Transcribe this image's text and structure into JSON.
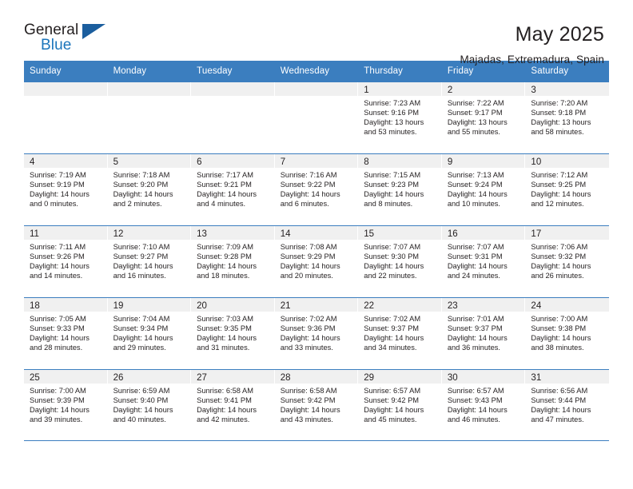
{
  "brand": {
    "word1": "General",
    "word2": "Blue",
    "triangle_color": "#1b5e9e",
    "blue_color": "#1b75bb"
  },
  "header": {
    "title": "May 2025",
    "subtitle": "Majadas, Extremadura, Spain"
  },
  "theme": {
    "header_band": "#3b7ebf",
    "daynum_band": "#f0f0f0",
    "text": "#231f20"
  },
  "weekday_headers": [
    "Sunday",
    "Monday",
    "Tuesday",
    "Wednesday",
    "Thursday",
    "Friday",
    "Saturday"
  ],
  "labels": {
    "sunrise_prefix": "Sunrise: ",
    "sunset_prefix": "Sunset: ",
    "daylight_prefix": "Daylight: "
  },
  "weeks": [
    [
      {
        "day": ""
      },
      {
        "day": ""
      },
      {
        "day": ""
      },
      {
        "day": ""
      },
      {
        "day": "1",
        "sunrise": "Sunrise: 7:23 AM",
        "sunset": "Sunset: 9:16 PM",
        "daylight_l1": "Daylight: 13 hours",
        "daylight_l2": "and 53 minutes."
      },
      {
        "day": "2",
        "sunrise": "Sunrise: 7:22 AM",
        "sunset": "Sunset: 9:17 PM",
        "daylight_l1": "Daylight: 13 hours",
        "daylight_l2": "and 55 minutes."
      },
      {
        "day": "3",
        "sunrise": "Sunrise: 7:20 AM",
        "sunset": "Sunset: 9:18 PM",
        "daylight_l1": "Daylight: 13 hours",
        "daylight_l2": "and 58 minutes."
      }
    ],
    [
      {
        "day": "4",
        "sunrise": "Sunrise: 7:19 AM",
        "sunset": "Sunset: 9:19 PM",
        "daylight_l1": "Daylight: 14 hours",
        "daylight_l2": "and 0 minutes."
      },
      {
        "day": "5",
        "sunrise": "Sunrise: 7:18 AM",
        "sunset": "Sunset: 9:20 PM",
        "daylight_l1": "Daylight: 14 hours",
        "daylight_l2": "and 2 minutes."
      },
      {
        "day": "6",
        "sunrise": "Sunrise: 7:17 AM",
        "sunset": "Sunset: 9:21 PM",
        "daylight_l1": "Daylight: 14 hours",
        "daylight_l2": "and 4 minutes."
      },
      {
        "day": "7",
        "sunrise": "Sunrise: 7:16 AM",
        "sunset": "Sunset: 9:22 PM",
        "daylight_l1": "Daylight: 14 hours",
        "daylight_l2": "and 6 minutes."
      },
      {
        "day": "8",
        "sunrise": "Sunrise: 7:15 AM",
        "sunset": "Sunset: 9:23 PM",
        "daylight_l1": "Daylight: 14 hours",
        "daylight_l2": "and 8 minutes."
      },
      {
        "day": "9",
        "sunrise": "Sunrise: 7:13 AM",
        "sunset": "Sunset: 9:24 PM",
        "daylight_l1": "Daylight: 14 hours",
        "daylight_l2": "and 10 minutes."
      },
      {
        "day": "10",
        "sunrise": "Sunrise: 7:12 AM",
        "sunset": "Sunset: 9:25 PM",
        "daylight_l1": "Daylight: 14 hours",
        "daylight_l2": "and 12 minutes."
      }
    ],
    [
      {
        "day": "11",
        "sunrise": "Sunrise: 7:11 AM",
        "sunset": "Sunset: 9:26 PM",
        "daylight_l1": "Daylight: 14 hours",
        "daylight_l2": "and 14 minutes."
      },
      {
        "day": "12",
        "sunrise": "Sunrise: 7:10 AM",
        "sunset": "Sunset: 9:27 PM",
        "daylight_l1": "Daylight: 14 hours",
        "daylight_l2": "and 16 minutes."
      },
      {
        "day": "13",
        "sunrise": "Sunrise: 7:09 AM",
        "sunset": "Sunset: 9:28 PM",
        "daylight_l1": "Daylight: 14 hours",
        "daylight_l2": "and 18 minutes."
      },
      {
        "day": "14",
        "sunrise": "Sunrise: 7:08 AM",
        "sunset": "Sunset: 9:29 PM",
        "daylight_l1": "Daylight: 14 hours",
        "daylight_l2": "and 20 minutes."
      },
      {
        "day": "15",
        "sunrise": "Sunrise: 7:07 AM",
        "sunset": "Sunset: 9:30 PM",
        "daylight_l1": "Daylight: 14 hours",
        "daylight_l2": "and 22 minutes."
      },
      {
        "day": "16",
        "sunrise": "Sunrise: 7:07 AM",
        "sunset": "Sunset: 9:31 PM",
        "daylight_l1": "Daylight: 14 hours",
        "daylight_l2": "and 24 minutes."
      },
      {
        "day": "17",
        "sunrise": "Sunrise: 7:06 AM",
        "sunset": "Sunset: 9:32 PM",
        "daylight_l1": "Daylight: 14 hours",
        "daylight_l2": "and 26 minutes."
      }
    ],
    [
      {
        "day": "18",
        "sunrise": "Sunrise: 7:05 AM",
        "sunset": "Sunset: 9:33 PM",
        "daylight_l1": "Daylight: 14 hours",
        "daylight_l2": "and 28 minutes."
      },
      {
        "day": "19",
        "sunrise": "Sunrise: 7:04 AM",
        "sunset": "Sunset: 9:34 PM",
        "daylight_l1": "Daylight: 14 hours",
        "daylight_l2": "and 29 minutes."
      },
      {
        "day": "20",
        "sunrise": "Sunrise: 7:03 AM",
        "sunset": "Sunset: 9:35 PM",
        "daylight_l1": "Daylight: 14 hours",
        "daylight_l2": "and 31 minutes."
      },
      {
        "day": "21",
        "sunrise": "Sunrise: 7:02 AM",
        "sunset": "Sunset: 9:36 PM",
        "daylight_l1": "Daylight: 14 hours",
        "daylight_l2": "and 33 minutes."
      },
      {
        "day": "22",
        "sunrise": "Sunrise: 7:02 AM",
        "sunset": "Sunset: 9:37 PM",
        "daylight_l1": "Daylight: 14 hours",
        "daylight_l2": "and 34 minutes."
      },
      {
        "day": "23",
        "sunrise": "Sunrise: 7:01 AM",
        "sunset": "Sunset: 9:37 PM",
        "daylight_l1": "Daylight: 14 hours",
        "daylight_l2": "and 36 minutes."
      },
      {
        "day": "24",
        "sunrise": "Sunrise: 7:00 AM",
        "sunset": "Sunset: 9:38 PM",
        "daylight_l1": "Daylight: 14 hours",
        "daylight_l2": "and 38 minutes."
      }
    ],
    [
      {
        "day": "25",
        "sunrise": "Sunrise: 7:00 AM",
        "sunset": "Sunset: 9:39 PM",
        "daylight_l1": "Daylight: 14 hours",
        "daylight_l2": "and 39 minutes."
      },
      {
        "day": "26",
        "sunrise": "Sunrise: 6:59 AM",
        "sunset": "Sunset: 9:40 PM",
        "daylight_l1": "Daylight: 14 hours",
        "daylight_l2": "and 40 minutes."
      },
      {
        "day": "27",
        "sunrise": "Sunrise: 6:58 AM",
        "sunset": "Sunset: 9:41 PM",
        "daylight_l1": "Daylight: 14 hours",
        "daylight_l2": "and 42 minutes."
      },
      {
        "day": "28",
        "sunrise": "Sunrise: 6:58 AM",
        "sunset": "Sunset: 9:42 PM",
        "daylight_l1": "Daylight: 14 hours",
        "daylight_l2": "and 43 minutes."
      },
      {
        "day": "29",
        "sunrise": "Sunrise: 6:57 AM",
        "sunset": "Sunset: 9:42 PM",
        "daylight_l1": "Daylight: 14 hours",
        "daylight_l2": "and 45 minutes."
      },
      {
        "day": "30",
        "sunrise": "Sunrise: 6:57 AM",
        "sunset": "Sunset: 9:43 PM",
        "daylight_l1": "Daylight: 14 hours",
        "daylight_l2": "and 46 minutes."
      },
      {
        "day": "31",
        "sunrise": "Sunrise: 6:56 AM",
        "sunset": "Sunset: 9:44 PM",
        "daylight_l1": "Daylight: 14 hours",
        "daylight_l2": "and 47 minutes."
      }
    ]
  ]
}
